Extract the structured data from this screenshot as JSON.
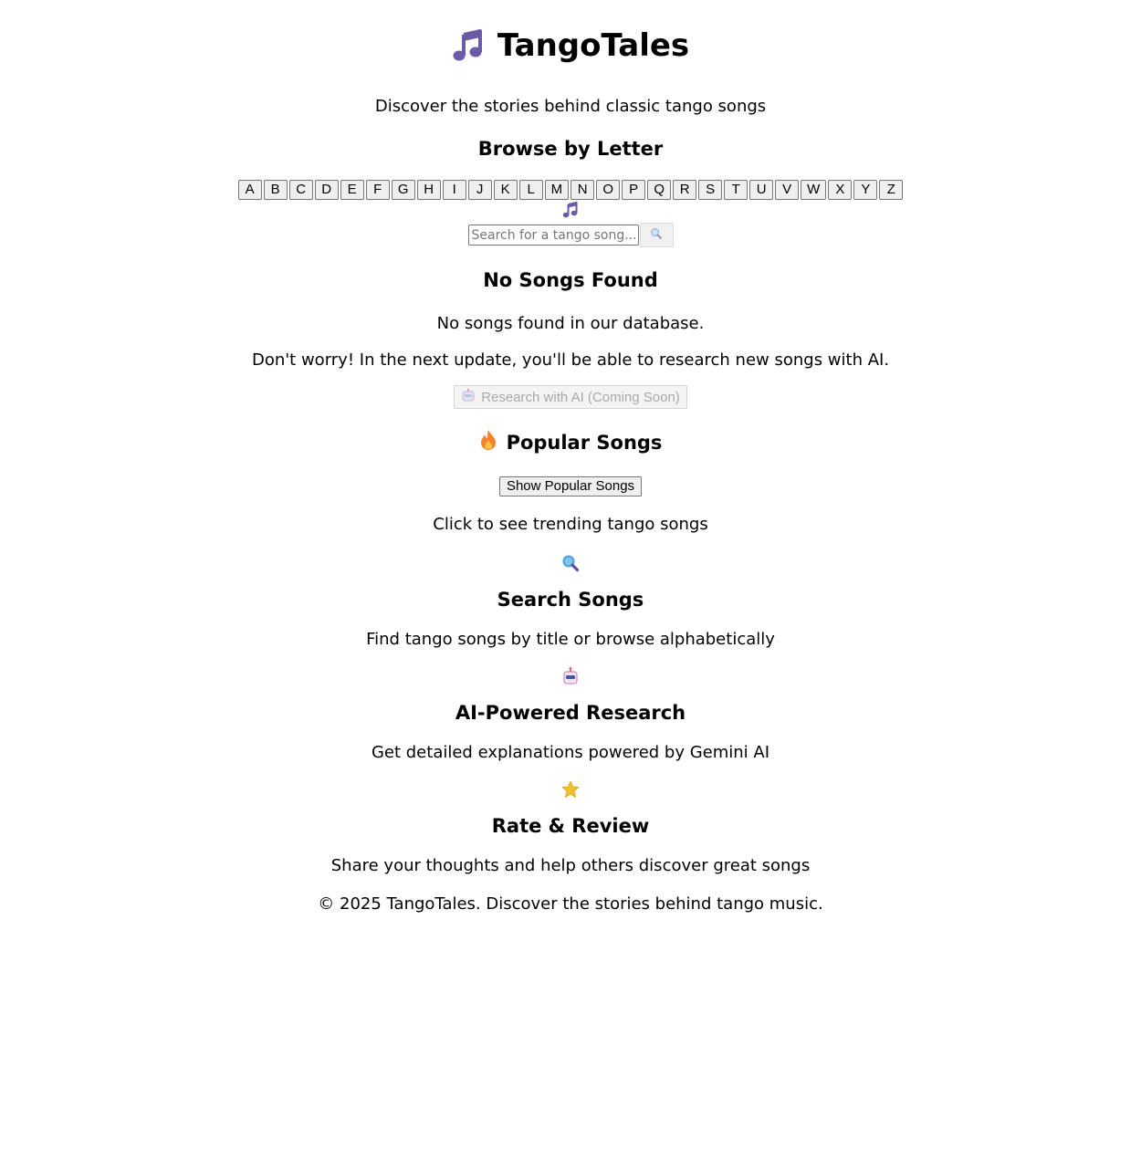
{
  "header": {
    "icon": "musical-notes-icon",
    "title": "TangoTales",
    "subtitle": "Discover the stories behind classic tango songs"
  },
  "browse": {
    "title": "Browse by Letter",
    "letters": [
      "A",
      "B",
      "C",
      "D",
      "E",
      "F",
      "G",
      "H",
      "I",
      "J",
      "K",
      "L",
      "M",
      "N",
      "O",
      "P",
      "Q",
      "R",
      "S",
      "T",
      "U",
      "V",
      "W",
      "X",
      "Y",
      "Z"
    ]
  },
  "search": {
    "placeholder": "Search for a tango song...",
    "button_icon": "magnifier-icon"
  },
  "results": {
    "title": "No Songs Found",
    "message": "No songs found in our database.",
    "hint": "Don't worry! In the next update, you'll be able to research new songs with AI.",
    "ai_button_label": "Research with AI (Coming Soon)",
    "ai_button_icon": "robot-icon"
  },
  "popular": {
    "icon": "fire-icon",
    "title": "Popular Songs",
    "button_label": "Show Popular Songs",
    "description": "Click to see trending tango songs"
  },
  "features": [
    {
      "icon": "magnifier-icon",
      "title": "Search Songs",
      "description": "Find tango songs by title or browse alphabetically"
    },
    {
      "icon": "robot-icon",
      "title": "AI-Powered Research",
      "description": "Get detailed explanations powered by Gemini AI"
    },
    {
      "icon": "star-icon",
      "title": "Rate & Review",
      "description": "Share your thoughts and help others discover great songs"
    }
  ],
  "footer": {
    "text": "© 2025 TangoTales. Discover the stories behind tango music."
  },
  "colors": {
    "note_purple": "#6a5aa8",
    "fire_orange": "#f5822a",
    "star_gold": "#f2c12e",
    "magnifier_blue": "#4aa3df",
    "disabled_text": "#a8a8a8"
  }
}
